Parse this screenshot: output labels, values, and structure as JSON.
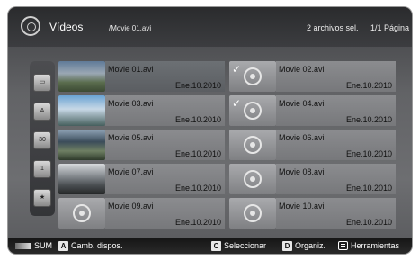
{
  "header": {
    "title": "Vídeos",
    "path": "/Movie 01.avi",
    "selection_count": "2 archivos sel.",
    "page_indicator": "1/1 Página"
  },
  "sidebar": {
    "items": [
      {
        "icon": "folder-icon",
        "label": ""
      },
      {
        "icon": "alphabetical-sort-icon",
        "label": "A"
      },
      {
        "icon": "calendar-icon",
        "label": "30"
      },
      {
        "icon": "timeline-icon",
        "label": "1"
      },
      {
        "icon": "favorite-star-icon",
        "label": "★"
      }
    ]
  },
  "files": [
    {
      "name": "Movie 01.avi",
      "date": "Ene.10.2010",
      "thumbnail": "video-frame",
      "checked": false,
      "focused": true
    },
    {
      "name": "Movie 02.avi",
      "date": "Ene.10.2010",
      "thumbnail": "film-reel-icon",
      "checked": true,
      "focused": false
    },
    {
      "name": "Movie 03.avi",
      "date": "Ene.10.2010",
      "thumbnail": "video-frame",
      "checked": false,
      "focused": false
    },
    {
      "name": "Movie 04.avi",
      "date": "Ene.10.2010",
      "thumbnail": "film-reel-icon",
      "checked": true,
      "focused": false
    },
    {
      "name": "Movie 05.avi",
      "date": "Ene.10.2010",
      "thumbnail": "video-frame",
      "checked": false,
      "focused": false
    },
    {
      "name": "Movie 06.avi",
      "date": "Ene.10.2010",
      "thumbnail": "film-reel-icon",
      "checked": false,
      "focused": false
    },
    {
      "name": "Movie 07.avi",
      "date": "Ene.10.2010",
      "thumbnail": "video-frame",
      "checked": false,
      "focused": false
    },
    {
      "name": "Movie 08.avi",
      "date": "Ene.10.2010",
      "thumbnail": "film-reel-icon",
      "checked": false,
      "focused": false
    },
    {
      "name": "Movie 09.avi",
      "date": "Ene.10.2010",
      "thumbnail": "film-reel-icon",
      "checked": false,
      "focused": false
    },
    {
      "name": "Movie 10.avi",
      "date": "Ene.10.2010",
      "thumbnail": "film-reel-icon",
      "checked": false,
      "focused": false
    }
  ],
  "footer": {
    "sum_label": "SUM",
    "change_device_key": "A",
    "change_device_label": "Camb. dispos.",
    "select_key": "C",
    "select_label": "Seleccionar",
    "organize_key": "D",
    "organize_label": "Organiz.",
    "tools_label": "Herramientas"
  },
  "colors": {
    "key_a": "#e7e7e7",
    "key_c": "#e7e7e7",
    "key_d": "#e7e7e7"
  }
}
